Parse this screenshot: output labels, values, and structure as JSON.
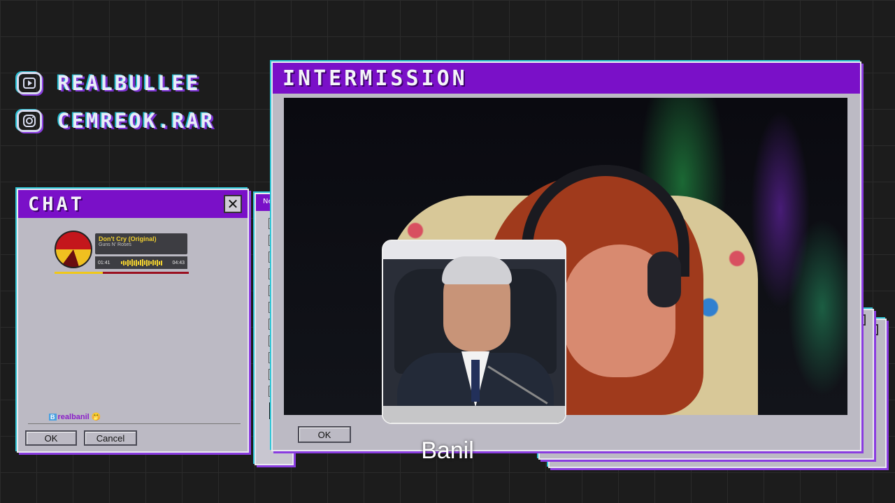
{
  "socials": [
    {
      "icon": "youtube-icon",
      "handle": "REALBULLEE"
    },
    {
      "icon": "instagram-icon",
      "handle": "CEMREOK.RAR"
    }
  ],
  "chat_window": {
    "title": "CHAT",
    "close_label": "✕",
    "ok_label": "OK",
    "cancel_label": "Cancel",
    "now_playing": {
      "song": "Don't Cry (Original)",
      "artist": "Guns N' Roses",
      "elapsed": "01:41",
      "duration": "04:43",
      "progress": 0.36
    },
    "messages": [
      {
        "badge": "B",
        "user": "realbanil",
        "emoji": "🤭"
      }
    ]
  },
  "paint_window": {
    "title_fragment": "Ne"
  },
  "main_window": {
    "title": "INTERMISSION",
    "ok_label": "OK",
    "close_label": "✕"
  },
  "caption": "Banil",
  "colors": {
    "title_purple": "#7a10c8",
    "window_gray": "#bcbac4",
    "accent_cyan": "#2fc6d6",
    "music_yellow": "#f0d030"
  }
}
